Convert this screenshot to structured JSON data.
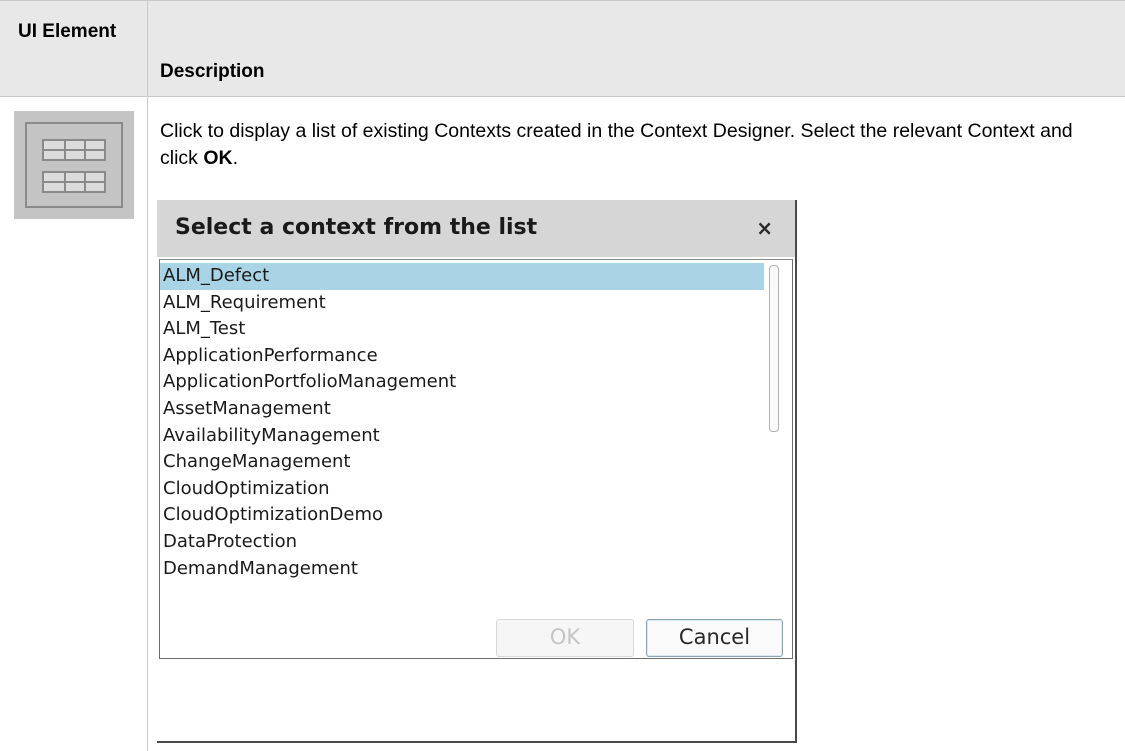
{
  "table": {
    "header_ui_element": "UI Element",
    "header_description": "Description"
  },
  "row": {
    "icon": "context-list-icon",
    "description_before": "Click to display a list of existing Contexts created in the Context Designer. Select the relevant Context and click ",
    "description_bold": "OK",
    "description_after": "."
  },
  "dialog": {
    "title": "Select a context from the list",
    "close_label": "×",
    "items": [
      {
        "label": "ALM_Defect",
        "selected": true
      },
      {
        "label": "ALM_Requirement",
        "selected": false
      },
      {
        "label": "ALM_Test",
        "selected": false
      },
      {
        "label": "ApplicationPerformance",
        "selected": false
      },
      {
        "label": "ApplicationPortfolioManagement",
        "selected": false
      },
      {
        "label": "AssetManagement",
        "selected": false
      },
      {
        "label": "AvailabilityManagement",
        "selected": false
      },
      {
        "label": "ChangeManagement",
        "selected": false
      },
      {
        "label": "CloudOptimization",
        "selected": false
      },
      {
        "label": "CloudOptimizationDemo",
        "selected": false
      },
      {
        "label": "DataProtection",
        "selected": false
      },
      {
        "label": "DemandManagement",
        "selected": false
      }
    ],
    "ok_label": "OK",
    "ok_enabled": false,
    "cancel_label": "Cancel"
  },
  "colors": {
    "header_bg": "#e8e8e8",
    "selection": "#a8d4e6",
    "title_bar": "#d6d6d6"
  }
}
